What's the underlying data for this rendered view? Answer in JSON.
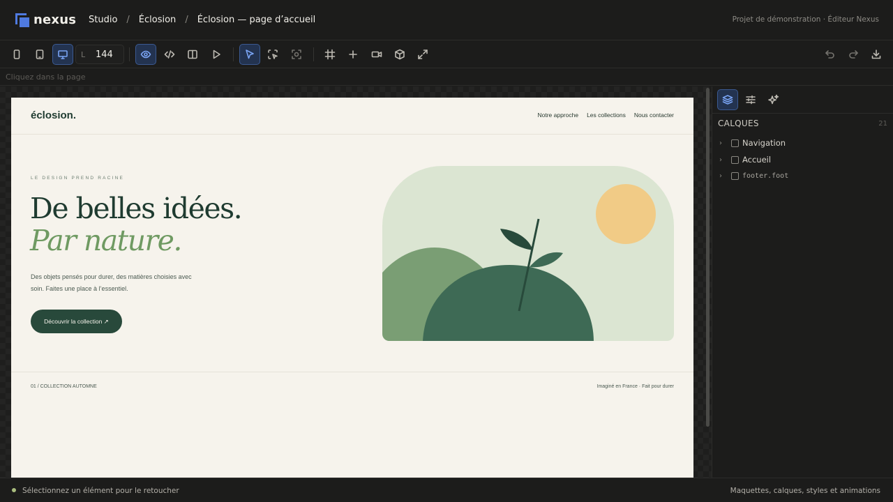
{
  "app": {
    "name": "nexus",
    "accent": "#4f7ae0"
  },
  "breadcrumb": [
    "Studio",
    "Éclosion",
    "Éclosion — page d’accueil"
  ],
  "project_label": "Projet de démonstration · Éditeur Nexus",
  "toolbar": {
    "width_label": "L",
    "width_value": "144",
    "icons_left": [
      "phone-icon",
      "tablet-icon",
      "desktop-icon"
    ],
    "icons_mid": [
      "eye-icon",
      "code-icon",
      "split-view-icon",
      "play-icon",
      "pointer-icon",
      "select-area-icon",
      "scan-icon",
      "frame-icon",
      "plus-icon",
      "video-icon",
      "cube-icon",
      "expand-icon"
    ],
    "icons_right": [
      "undo-icon",
      "redo-icon",
      "download-icon"
    ]
  },
  "hint": "Cliquez dans la page",
  "preview": {
    "brand": "éclosion.",
    "nav": [
      "Notre approche",
      "Les collections",
      "Nous contacter"
    ],
    "eyebrow": "LE DESIGN PREND RACINE",
    "headline": "De belles idées.",
    "headline_accent": "Par nature.",
    "lead": "Des objets pensés pour durer, des matières choisies avec soin. Faites une place à l’essentiel.",
    "cta": "Découvrir la collection ↗",
    "footer_left": "01 / COLLECTION AUTOMNE",
    "footer_right": "Imaginé en France · Fait pour durer",
    "colors": {
      "background": "#f6f3ec",
      "dark_green": "#28493b",
      "sage": "#6f9a62",
      "light_sage": "#dbe5d2",
      "sun": "#f1cb86"
    }
  },
  "panel": {
    "tabs": [
      "layers-icon",
      "sliders-icon",
      "sparkles-icon"
    ],
    "title": "CALQUES",
    "count": "21",
    "layers": [
      "Navigation",
      "Accueil",
      "footer.foot"
    ]
  },
  "status": {
    "left": "Sélectionnez un élément pour le retoucher",
    "right": "Maquettes, calques, styles et animations"
  }
}
